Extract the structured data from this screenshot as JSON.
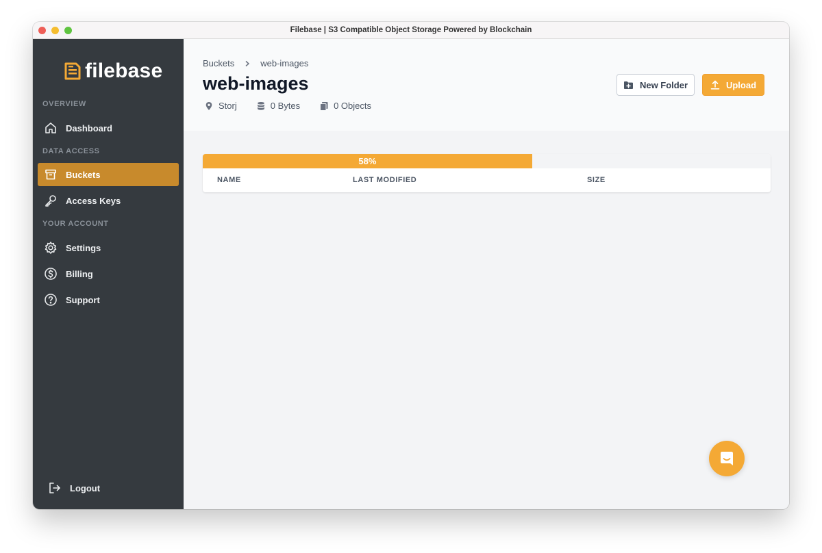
{
  "window": {
    "title": "Filebase | S3 Compatible Object Storage Powered by Blockchain"
  },
  "colors": {
    "sidebar_bg": "#353a3f",
    "accent": "#f4a935",
    "active_nav": "#c88a2c"
  },
  "sidebar": {
    "logo_text": "filebase",
    "logo_icon": "file-logo-icon",
    "sections": {
      "overview": "OVERVIEW",
      "data_access": "DATA ACCESS",
      "your_account": "YOUR ACCOUNT"
    },
    "items": [
      {
        "label": "Dashboard",
        "icon": "home-icon"
      },
      {
        "label": "Buckets",
        "icon": "archive-icon",
        "active": true
      },
      {
        "label": "Access Keys",
        "icon": "key-icon"
      },
      {
        "label": "Settings",
        "icon": "gear-icon"
      },
      {
        "label": "Billing",
        "icon": "dollar-icon"
      },
      {
        "label": "Support",
        "icon": "help-icon"
      }
    ],
    "logout_label": "Logout"
  },
  "header": {
    "breadcrumb": [
      "Buckets",
      "web-images"
    ],
    "title": "web-images",
    "meta": {
      "network": "Storj",
      "size": "0 Bytes",
      "objects": "0 Objects"
    },
    "new_folder_label": "New Folder",
    "upload_label": "Upload"
  },
  "upload_progress": {
    "percent": 58,
    "label": "58%"
  },
  "table": {
    "columns": [
      "NAME",
      "LAST MODIFIED",
      "SIZE"
    ]
  }
}
